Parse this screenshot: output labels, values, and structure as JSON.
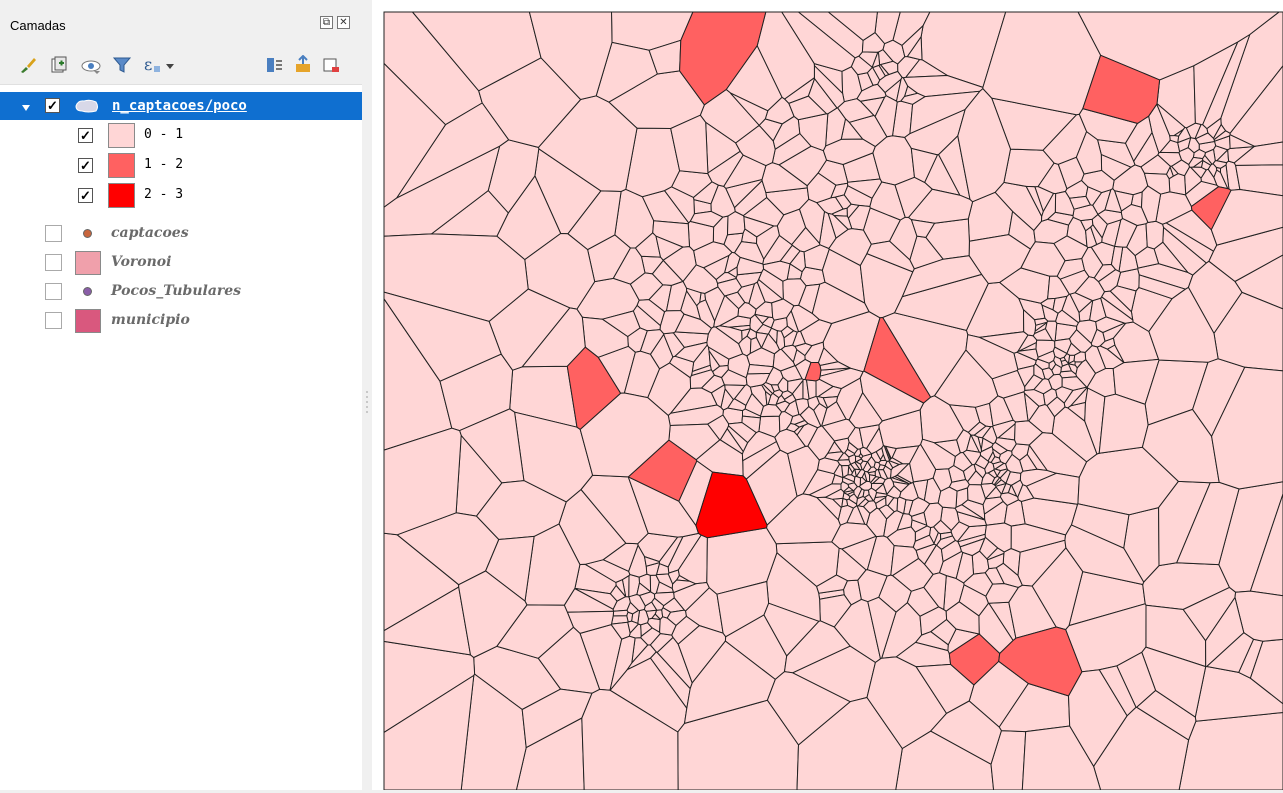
{
  "panel": {
    "title": "Camadas",
    "float_icon": "float-icon",
    "close_icon": "close-icon"
  },
  "toolbar": {
    "icons": [
      "style-brush-icon",
      "add-group-icon",
      "eye-icon",
      "filter-icon",
      "expression-filter-icon",
      "expand-all-icon",
      "collapse-all-icon",
      "remove-layer-icon"
    ]
  },
  "layers": {
    "selected": {
      "name": "n_captacoes/poco",
      "checked": true
    },
    "classes": [
      {
        "label": "0 - 1",
        "color": "#ffd6d6",
        "checked": true
      },
      {
        "label": "1 - 2",
        "color": "#ff6161",
        "checked": true
      },
      {
        "label": "2 - 3",
        "color": "#ff0000",
        "checked": true
      }
    ],
    "others": [
      {
        "name": "captacoes",
        "color": "#c8653d",
        "symbol": "point",
        "checked": false
      },
      {
        "name": "Voronoi",
        "color": "#f0a0ab",
        "symbol": "polygon",
        "checked": false
      },
      {
        "name": "Pocos_Tubulares",
        "color": "#8a5ea8",
        "symbol": "point",
        "checked": false
      },
      {
        "name": "municipio",
        "color": "#d9587e",
        "symbol": "polygon",
        "checked": false
      }
    ]
  },
  "map": {
    "base_fill": "#ffd6d6",
    "stroke": "#222222",
    "class_colors": [
      "#ffd6d6",
      "#ff6161",
      "#ff0000"
    ]
  }
}
